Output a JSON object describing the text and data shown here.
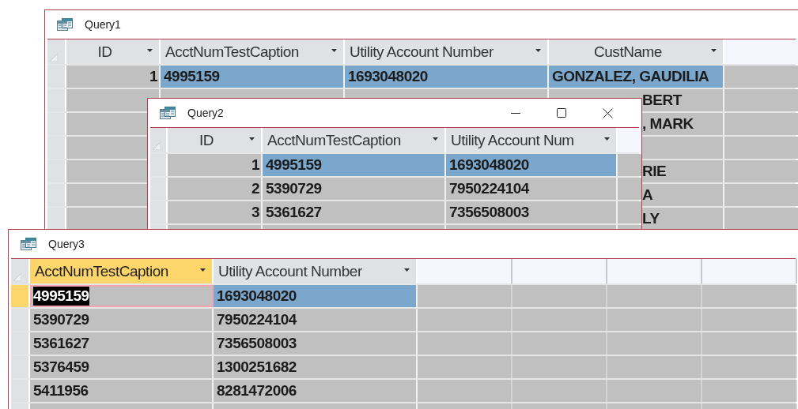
{
  "windows": [
    {
      "title": "Query1",
      "active": false,
      "controls": false,
      "columns": [
        {
          "label": "ID",
          "selected": false
        },
        {
          "label": "AcctNumTestCaption",
          "selected": false
        },
        {
          "label": "Utility Account Number",
          "selected": false
        },
        {
          "label": "CustName",
          "selected": false
        }
      ],
      "rows": [
        {
          "selected": true,
          "cells": [
            "1",
            "4995159",
            "1693048020",
            "GONZALEZ, GAUDILIA"
          ]
        },
        {
          "selected": false,
          "partial": "BERT"
        },
        {
          "selected": false,
          "partial": ", MARK"
        },
        {
          "selected": false
        },
        {
          "selected": false,
          "partial": "RIE"
        },
        {
          "selected": false,
          "partial": "A"
        },
        {
          "selected": false,
          "partial": "LY"
        }
      ]
    },
    {
      "title": "Query2",
      "active": false,
      "controls": true,
      "columns": [
        {
          "label": "ID",
          "selected": false
        },
        {
          "label": "AcctNumTestCaption",
          "selected": false
        },
        {
          "label": "Utility Account Num",
          "selected": false
        }
      ],
      "rows": [
        {
          "selected": true,
          "cells": [
            "1",
            "4995159",
            "1693048020"
          ]
        },
        {
          "selected": false,
          "cells": [
            "2",
            "5390729",
            "7950224104"
          ]
        },
        {
          "selected": false,
          "cells": [
            "3",
            "5361627",
            "7356508003"
          ]
        }
      ]
    },
    {
      "title": "Query3",
      "active": true,
      "controls": false,
      "columns": [
        {
          "label": "AcctNumTestCaption",
          "selected": true
        },
        {
          "label": "Utility Account Number",
          "selected": false
        }
      ],
      "rows": [
        {
          "selected": true,
          "cells": [
            {
              "text": "4995159",
              "focused": true
            },
            {
              "text": "1693048020",
              "focused": false
            }
          ]
        },
        {
          "selected": false,
          "cells": [
            "5390729",
            "7950224104"
          ]
        },
        {
          "selected": false,
          "cells": [
            "5361627",
            "7356508003"
          ]
        },
        {
          "selected": false,
          "cells": [
            "5376459",
            "1300251682"
          ]
        },
        {
          "selected": false,
          "cells": [
            "5411956",
            "8281472006"
          ]
        }
      ]
    }
  ]
}
